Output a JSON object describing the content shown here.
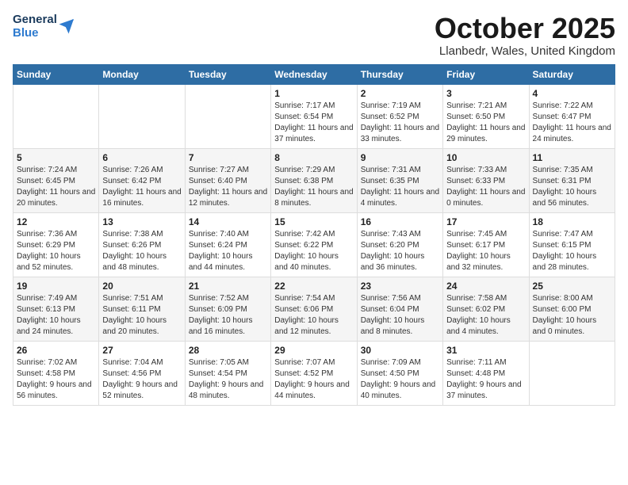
{
  "header": {
    "logo_line1": "General",
    "logo_line2": "Blue",
    "month": "October 2025",
    "location": "Llanbedr, Wales, United Kingdom"
  },
  "weekdays": [
    "Sunday",
    "Monday",
    "Tuesday",
    "Wednesday",
    "Thursday",
    "Friday",
    "Saturday"
  ],
  "weeks": [
    [
      {
        "day": "",
        "info": ""
      },
      {
        "day": "",
        "info": ""
      },
      {
        "day": "",
        "info": ""
      },
      {
        "day": "1",
        "info": "Sunrise: 7:17 AM\nSunset: 6:54 PM\nDaylight: 11 hours and 37 minutes."
      },
      {
        "day": "2",
        "info": "Sunrise: 7:19 AM\nSunset: 6:52 PM\nDaylight: 11 hours and 33 minutes."
      },
      {
        "day": "3",
        "info": "Sunrise: 7:21 AM\nSunset: 6:50 PM\nDaylight: 11 hours and 29 minutes."
      },
      {
        "day": "4",
        "info": "Sunrise: 7:22 AM\nSunset: 6:47 PM\nDaylight: 11 hours and 24 minutes."
      }
    ],
    [
      {
        "day": "5",
        "info": "Sunrise: 7:24 AM\nSunset: 6:45 PM\nDaylight: 11 hours and 20 minutes."
      },
      {
        "day": "6",
        "info": "Sunrise: 7:26 AM\nSunset: 6:42 PM\nDaylight: 11 hours and 16 minutes."
      },
      {
        "day": "7",
        "info": "Sunrise: 7:27 AM\nSunset: 6:40 PM\nDaylight: 11 hours and 12 minutes."
      },
      {
        "day": "8",
        "info": "Sunrise: 7:29 AM\nSunset: 6:38 PM\nDaylight: 11 hours and 8 minutes."
      },
      {
        "day": "9",
        "info": "Sunrise: 7:31 AM\nSunset: 6:35 PM\nDaylight: 11 hours and 4 minutes."
      },
      {
        "day": "10",
        "info": "Sunrise: 7:33 AM\nSunset: 6:33 PM\nDaylight: 11 hours and 0 minutes."
      },
      {
        "day": "11",
        "info": "Sunrise: 7:35 AM\nSunset: 6:31 PM\nDaylight: 10 hours and 56 minutes."
      }
    ],
    [
      {
        "day": "12",
        "info": "Sunrise: 7:36 AM\nSunset: 6:29 PM\nDaylight: 10 hours and 52 minutes."
      },
      {
        "day": "13",
        "info": "Sunrise: 7:38 AM\nSunset: 6:26 PM\nDaylight: 10 hours and 48 minutes."
      },
      {
        "day": "14",
        "info": "Sunrise: 7:40 AM\nSunset: 6:24 PM\nDaylight: 10 hours and 44 minutes."
      },
      {
        "day": "15",
        "info": "Sunrise: 7:42 AM\nSunset: 6:22 PM\nDaylight: 10 hours and 40 minutes."
      },
      {
        "day": "16",
        "info": "Sunrise: 7:43 AM\nSunset: 6:20 PM\nDaylight: 10 hours and 36 minutes."
      },
      {
        "day": "17",
        "info": "Sunrise: 7:45 AM\nSunset: 6:17 PM\nDaylight: 10 hours and 32 minutes."
      },
      {
        "day": "18",
        "info": "Sunrise: 7:47 AM\nSunset: 6:15 PM\nDaylight: 10 hours and 28 minutes."
      }
    ],
    [
      {
        "day": "19",
        "info": "Sunrise: 7:49 AM\nSunset: 6:13 PM\nDaylight: 10 hours and 24 minutes."
      },
      {
        "day": "20",
        "info": "Sunrise: 7:51 AM\nSunset: 6:11 PM\nDaylight: 10 hours and 20 minutes."
      },
      {
        "day": "21",
        "info": "Sunrise: 7:52 AM\nSunset: 6:09 PM\nDaylight: 10 hours and 16 minutes."
      },
      {
        "day": "22",
        "info": "Sunrise: 7:54 AM\nSunset: 6:06 PM\nDaylight: 10 hours and 12 minutes."
      },
      {
        "day": "23",
        "info": "Sunrise: 7:56 AM\nSunset: 6:04 PM\nDaylight: 10 hours and 8 minutes."
      },
      {
        "day": "24",
        "info": "Sunrise: 7:58 AM\nSunset: 6:02 PM\nDaylight: 10 hours and 4 minutes."
      },
      {
        "day": "25",
        "info": "Sunrise: 8:00 AM\nSunset: 6:00 PM\nDaylight: 10 hours and 0 minutes."
      }
    ],
    [
      {
        "day": "26",
        "info": "Sunrise: 7:02 AM\nSunset: 4:58 PM\nDaylight: 9 hours and 56 minutes."
      },
      {
        "day": "27",
        "info": "Sunrise: 7:04 AM\nSunset: 4:56 PM\nDaylight: 9 hours and 52 minutes."
      },
      {
        "day": "28",
        "info": "Sunrise: 7:05 AM\nSunset: 4:54 PM\nDaylight: 9 hours and 48 minutes."
      },
      {
        "day": "29",
        "info": "Sunrise: 7:07 AM\nSunset: 4:52 PM\nDaylight: 9 hours and 44 minutes."
      },
      {
        "day": "30",
        "info": "Sunrise: 7:09 AM\nSunset: 4:50 PM\nDaylight: 9 hours and 40 minutes."
      },
      {
        "day": "31",
        "info": "Sunrise: 7:11 AM\nSunset: 4:48 PM\nDaylight: 9 hours and 37 minutes."
      },
      {
        "day": "",
        "info": ""
      }
    ]
  ]
}
